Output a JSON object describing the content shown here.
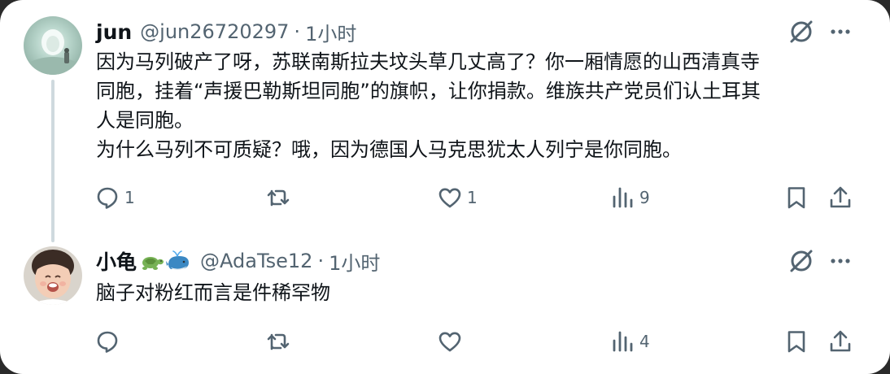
{
  "colors": {
    "text": "#0f1419",
    "muted": "#536471",
    "thread_line": "#cfd9de",
    "background": "#ffffff"
  },
  "tweets": [
    {
      "name": "jun",
      "handle": "@jun26720297",
      "separator": "·",
      "time": "1小时",
      "lines": [
        "因为马列破产了呀，苏联南斯拉夫坟头草几丈高了？你一厢情愿的山西清真寺",
        "同胞，挂着“声援巴勒斯坦同胞”的旗帜，让你捐款。维族共产党员们认土耳其",
        "人是同胞。",
        "为什么马列不可质疑？哦，因为德国人马克思犹太人列宁是你同胞。"
      ],
      "actions": {
        "reply_count": "1",
        "retweet_count": "",
        "like_count": "1",
        "views_count": "9"
      },
      "icons": [
        "grok-icon",
        "more-icon",
        "reply-icon",
        "retweet-icon",
        "like-icon",
        "views-icon",
        "bookmark-icon",
        "share-icon"
      ]
    },
    {
      "name": "小龟",
      "name_emojis": [
        "turtle-emoji",
        "whale-emoji"
      ],
      "handle": "@AdaTse12",
      "separator": "·",
      "time": "1小时",
      "lines": [
        "脑子对粉红而言是件稀罕物"
      ],
      "actions": {
        "reply_count": "",
        "retweet_count": "",
        "like_count": "",
        "views_count": "4"
      },
      "icons": [
        "grok-icon",
        "more-icon",
        "reply-icon",
        "retweet-icon",
        "like-icon",
        "views-icon",
        "bookmark-icon",
        "share-icon"
      ]
    }
  ]
}
